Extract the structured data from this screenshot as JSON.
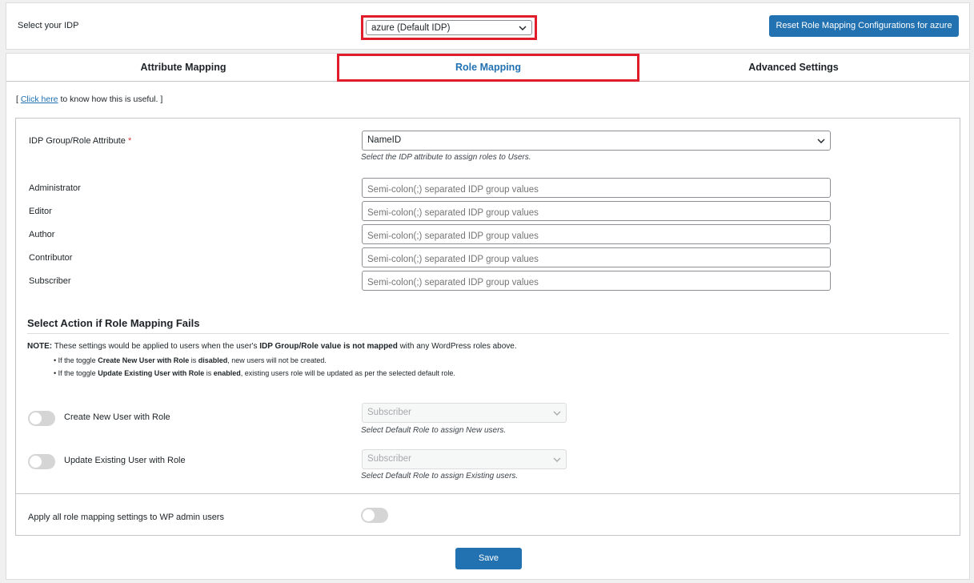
{
  "idp_bar": {
    "label": "Select your IDP",
    "selected_idp": "azure (Default IDP)",
    "reset_button": "Reset Role Mapping Configurations for azure"
  },
  "tabs": [
    {
      "label": "Attribute Mapping"
    },
    {
      "label": "Role Mapping"
    },
    {
      "label": "Advanced Settings"
    }
  ],
  "help": {
    "open": "[",
    "link": "Click here",
    "rest": "to know how this is useful. ]"
  },
  "group_attr": {
    "label": "IDP Group/Role Attribute",
    "required_mark": "*",
    "value": "NameID",
    "hint": "Select the IDP attribute to assign roles to Users."
  },
  "roles": [
    {
      "label": "Administrator",
      "placeholder": "Semi-colon(;) separated IDP group values"
    },
    {
      "label": "Editor",
      "placeholder": "Semi-colon(;) separated IDP group values"
    },
    {
      "label": "Author",
      "placeholder": "Semi-colon(;) separated IDP group values"
    },
    {
      "label": "Contributor",
      "placeholder": "Semi-colon(;) separated IDP group values"
    },
    {
      "label": "Subscriber",
      "placeholder": "Semi-colon(;) separated IDP group values"
    }
  ],
  "fail_section": {
    "title": "Select Action if Role Mapping Fails",
    "note_label": "NOTE:",
    "note_a": "These settings would be applied to users when the user's",
    "note_b": "IDP Group/Role value is not mapped",
    "note_c": "with any WordPress roles above.",
    "bullet1_a": "• If the toggle",
    "bullet1_b": "Create New User with Role",
    "bullet1_c": "is",
    "bullet1_d": "disabled",
    "bullet1_e": ", new users will not be created.",
    "bullet2_a": "• If the toggle",
    "bullet2_b": "Update Existing User with Role",
    "bullet2_c": "is",
    "bullet2_d": "enabled",
    "bullet2_e": ", existing users role will be updated as per the selected default role."
  },
  "create_toggle": {
    "label": "Create New User with Role",
    "enabled": false,
    "role": "Subscriber",
    "hint": "Select Default Role to assign New users."
  },
  "update_toggle": {
    "label": "Update Existing User with Role",
    "enabled": false,
    "role": "Subscriber",
    "hint": "Select Default Role to assign Existing users."
  },
  "admin_toggle": {
    "label": "Apply all role mapping settings to WP admin users",
    "enabled": false
  },
  "save_button": "Save",
  "colors": {
    "accent": "#2271b1",
    "highlight": "#e01e2b"
  }
}
